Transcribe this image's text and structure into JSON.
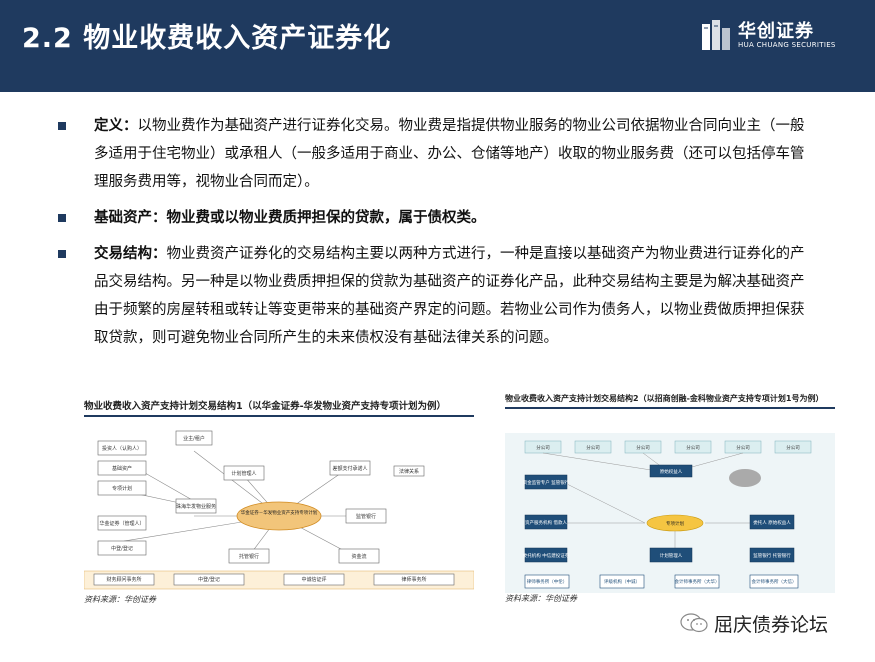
{
  "header": {
    "title": "2.2 物业收费收入资产证券化",
    "logo_cn": "华创证券",
    "logo_en": "HUA CHUANG SECURITIES"
  },
  "bullets": [
    {
      "key": "定义：",
      "text": "以物业费作为基础资产进行证券化交易。物业费是指提供物业服务的物业公司依据物业合同向业主（一般多适用于住宅物业）或承租人（一般多适用于商业、办公、仓储等地产）收取的物业服务费（还可以包括停车管理服务费用等，视物业合同而定）。"
    },
    {
      "key": "基础资产：",
      "text": "物业费或以物业费质押担保的贷款，属于债权类。"
    },
    {
      "key": "交易结构：",
      "text": "物业费资产证券化的交易结构主要以两种方式进行，一种是直接以基础资产为物业费进行证券化的产品交易结构。另一种是以物业费质押担保的贷款为基础资产的证券化产品，此种交易结构主要是为解决基础资产由于频繁的房屋转租或转让等变更带来的基础资产界定的问题。若物业公司作为债务人，以物业费做质押担保获取贷款，则可避免物业合同所产生的未来债权没有基础法律关系的问题。"
    }
  ],
  "figure1": {
    "title": "物业收费收入资产支持计划交易结构1（以华金证券-华发物业资产支持专项计划为例）",
    "source": "资料来源：华创证券",
    "center_node": "华金证券－华发物业资产支持专项计划",
    "nodes": [
      "投资人（认购人）",
      "法律关系",
      "资金流",
      "业主/租户",
      "计划管理人",
      "珠海华发物业服务",
      "差额支付承诺人",
      "监管银行",
      "托管银行",
      "基础资产",
      "专项计划",
      "华金证券（管理人）",
      "中登/登记",
      "律师事务所",
      "中诚信证评",
      "财务顾问事务所"
    ]
  },
  "figure2": {
    "title": "物业收费收入资产支持计划交易结构2（以招商创融-金科物业资产支持专项计划1号为例）",
    "source": "资料来源：华创证券",
    "top_nodes": [
      "分公司",
      "分公司",
      "分公司",
      "分公司",
      "分公司",
      "分公司"
    ],
    "left_nodes": [
      "资金监管专户 监管银行",
      "资产服务机构 借款人",
      "委托机构 中信建投证券"
    ],
    "middle_nodes": [
      "委托贷款",
      "原始权益人",
      "计划管理人"
    ],
    "center_node": "专项计划",
    "right_nodes": [
      "委托人 原始权益人",
      "监管银行 托管银行"
    ],
    "bottom_nodes": [
      "律师事务所（中伦）",
      "评级机构（中诚）",
      "会计师事务所（大华）",
      "会计师事务所（大信）"
    ]
  },
  "watermark": {
    "text": "屈庆债券论坛"
  },
  "colors": {
    "header_bg": "#1f3a5f",
    "bullet_mark": "#1f3a5f",
    "accent_orange": "#f0a030"
  }
}
